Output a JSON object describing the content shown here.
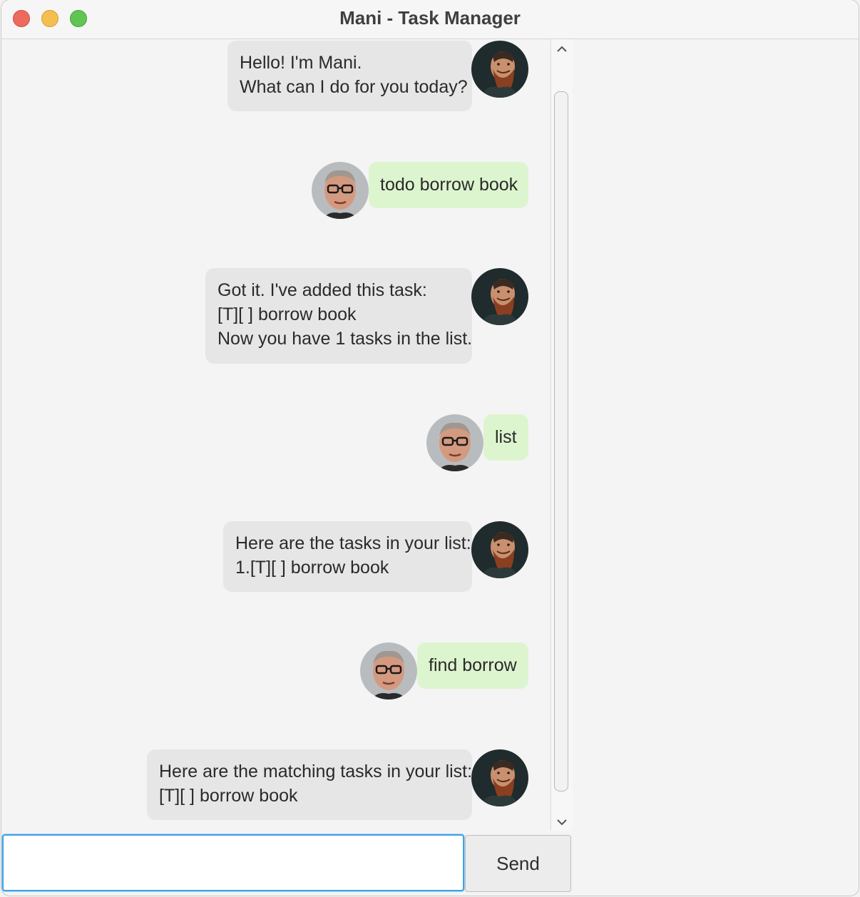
{
  "window": {
    "title": "Mani - Task Manager"
  },
  "messages": [
    {
      "sender": "bot",
      "text": "Hello! I'm Mani.\nWhat can I do for you today?"
    },
    {
      "sender": "user",
      "text": "todo borrow book"
    },
    {
      "sender": "bot",
      "text": "Got it. I've added this task:\n[T][ ] borrow book\nNow you have 1 tasks in the list."
    },
    {
      "sender": "user",
      "text": "list"
    },
    {
      "sender": "bot",
      "text": "Here are the tasks in your list:\n1.[T][ ] borrow book"
    },
    {
      "sender": "user",
      "text": "find borrow"
    },
    {
      "sender": "bot",
      "text": "Here are the matching tasks in your list:\n[T][ ] borrow book"
    }
  ],
  "input": {
    "value": "",
    "placeholder": ""
  },
  "send_button": {
    "label": "Send"
  },
  "icons": {
    "bot_avatar": "bearded-man-avatar-icon",
    "user_avatar": "man-with-glasses-avatar-icon",
    "scroll_up": "chevron-up-icon",
    "scroll_down": "chevron-down-icon"
  },
  "colors": {
    "bot_bubble": "#e6e6e6",
    "user_bubble": "#ddf5cf",
    "input_focus": "#3ea3e3"
  }
}
